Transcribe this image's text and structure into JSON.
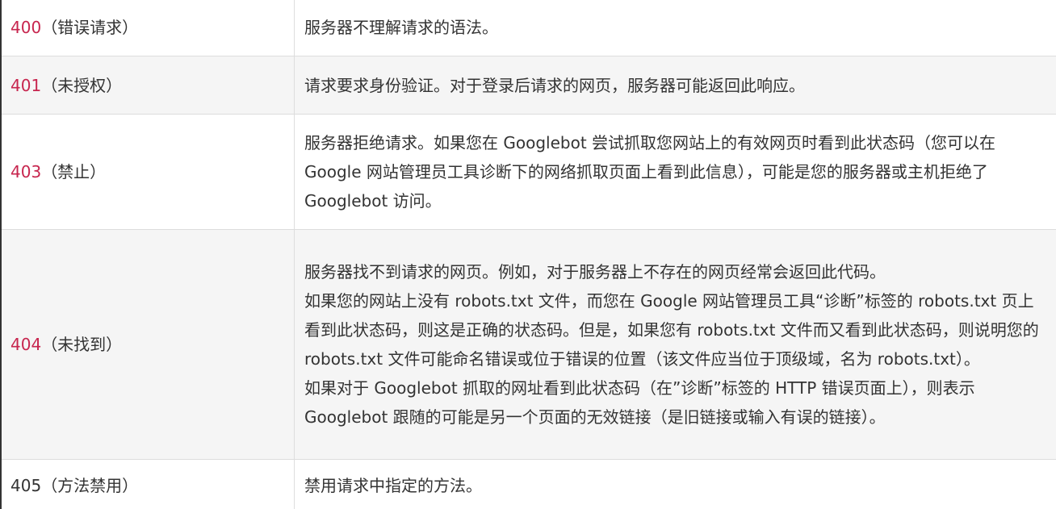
{
  "rows": [
    {
      "code": "400",
      "label": "（错误请求）",
      "description": [
        "服务器不理解请求的语法。"
      ]
    },
    {
      "code": "401",
      "label": "（未授权）",
      "description": [
        "请求要求身份验证。对于登录后请求的网页，服务器可能返回此响应。"
      ]
    },
    {
      "code": "403",
      "label": "（禁止）",
      "description": [
        "服务器拒绝请求。如果您在 Googlebot 尝试抓取您网站上的有效网页时看到此状态码（您可以在 Google 网站管理员工具诊断下的网络抓取页面上看到此信息），可能是您的服务器或主机拒绝了 Googlebot 访问。"
      ]
    },
    {
      "code": "404",
      "label": "（未找到）",
      "description": [
        "服务器找不到请求的网页。例如，对于服务器上不存在的网页经常会返回此代码。",
        "如果您的网站上没有 robots.txt 文件，而您在 Google 网站管理员工具“诊断”标签的 robots.txt 页上看到此状态码，则这是正确的状态码。但是，如果您有 robots.txt 文件而又看到此状态码，则说明您的 robots.txt 文件可能命名错误或位于错误的位置（该文件应当位于顶级域，名为 robots.txt）。",
        "如果对于 Googlebot 抓取的网址看到此状态码（在”诊断”标签的 HTTP 错误页面上），则表示 Googlebot 跟随的可能是另一个页面的无效链接（是旧链接或输入有误的链接）。"
      ]
    },
    {
      "code": "405",
      "label": "（方法禁用）",
      "description": [
        "禁用请求中指定的方法。"
      ]
    }
  ],
  "colors": {
    "code_highlight": "#c7254e",
    "text": "#333333",
    "border": "#dddddd",
    "stripe": "#f5f5f5"
  }
}
